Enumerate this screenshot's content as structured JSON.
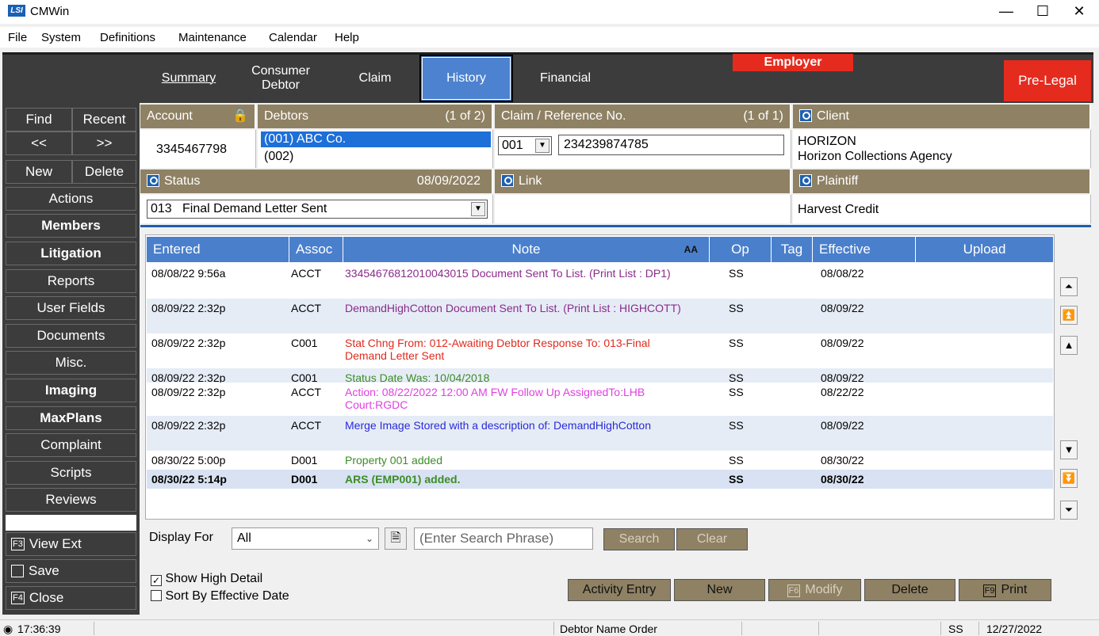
{
  "window": {
    "title": "CMWin",
    "minimize": "—",
    "maximize": "☐",
    "close": "✕"
  },
  "menu": [
    "File",
    "System",
    "Definitions",
    "Maintenance",
    "Calendar",
    "Help"
  ],
  "tabs": {
    "summary": "Summary",
    "consumer": "Consumer",
    "debtor": "Debtor",
    "claim": "Claim",
    "history": "History",
    "financial": "Financial",
    "employer": "Employer",
    "prelegal": "Pre-Legal"
  },
  "nav": {
    "find": "Find",
    "recent": "Recent",
    "prev": "<<",
    "next": ">>",
    "new": "New",
    "delete": "Delete",
    "items": [
      "Actions",
      "Members",
      "Litigation",
      "Reports",
      "User Fields",
      "Documents",
      "Misc.",
      "Imaging",
      "MaxPlans",
      "Complaint",
      "Scripts",
      "Reviews"
    ],
    "view_ext_key": "F3",
    "view_ext": "View Ext",
    "save": "Save",
    "close_key": "F4",
    "close": "Close"
  },
  "account": {
    "label": "Account",
    "value": "3345467798"
  },
  "debtors": {
    "label": "Debtors",
    "count": "(1 of 2)",
    "items": [
      "(001) ABC Co.",
      "(002)"
    ]
  },
  "claim_ref": {
    "label": "Claim / Reference No.",
    "count": "(1 of 1)",
    "select": "001",
    "value": "234239874785"
  },
  "client": {
    "label": "Client",
    "line1": "HORIZON",
    "line2": "Horizon Collections Agency"
  },
  "status": {
    "label": "Status",
    "date": "08/09/2022",
    "value": "013   Final Demand Letter Sent"
  },
  "link": {
    "label": "Link"
  },
  "plaintiff": {
    "label": "Plaintiff",
    "value": "Harvest Credit"
  },
  "grid": {
    "columns": [
      "Entered",
      "Assoc",
      "Note",
      "Op",
      "Tag",
      "Effective",
      "Upload"
    ],
    "font_icon": "AA",
    "rows": [
      {
        "entered": "08/08/22 9:56a",
        "assoc": "ACCT",
        "note": "33454676812010043015 Document Sent To List. (Print List : DP1)",
        "op": "SS",
        "effective": "08/08/22",
        "color": "#8a2b8a"
      },
      {
        "entered": "08/09/22 2:32p",
        "assoc": "ACCT",
        "note": "DemandHighCotton Document Sent To List. (Print List : HIGHCOTT)",
        "op": "SS",
        "effective": "08/09/22",
        "color": "#8a2b8a"
      },
      {
        "entered": "08/09/22 2:32p",
        "assoc": "C001",
        "note": "Stat Chng From: 012-Awaiting Debtor Response To: 013-Final Demand Letter Sent",
        "op": "SS",
        "effective": "08/09/22",
        "color": "#e02a1e"
      },
      {
        "entered": "08/09/22 2:32p",
        "assoc": "C001",
        "note": "Status Date Was: 10/04/2018",
        "op": "SS",
        "effective": "08/09/22",
        "color": "#3c8c28"
      },
      {
        "entered": "08/09/22 2:32p",
        "assoc": "ACCT",
        "note": "Action: 08/22/2022  12:00 AM  FW  Follow Up AssignedTo:LHB Court:RGDC",
        "op": "SS",
        "effective": "08/22/22",
        "color": "#e040e0"
      },
      {
        "entered": "08/09/22 2:32p",
        "assoc": "ACCT",
        "note": "Merge Image Stored with a description of: DemandHighCotton",
        "op": "SS",
        "effective": "08/09/22",
        "color": "#2a2ad8"
      },
      {
        "entered": "08/30/22 5:00p",
        "assoc": "D001",
        "note": "Property 001 added",
        "op": "SS",
        "effective": "08/30/22",
        "color": "#3c8c28"
      },
      {
        "entered": "08/30/22 5:14p",
        "assoc": "D001",
        "note": "ARS (EMP001) added.",
        "op": "SS",
        "effective": "08/30/22",
        "color": "#3c8c28"
      }
    ]
  },
  "filter": {
    "display_for_label": "Display For",
    "display_for_value": "All",
    "search_placeholder": "(Enter Search Phrase)",
    "search": "Search",
    "clear": "Clear",
    "show_high_detail": "Show High Detail",
    "sort_by_effective": "Sort By Effective Date"
  },
  "actions": {
    "activity_entry": "Activity Entry",
    "new": "New",
    "modify_key": "F6",
    "modify": "Modify",
    "delete": "Delete",
    "print_key": "F9",
    "print": "Print"
  },
  "statusbar": {
    "time": "17:36:39",
    "order": "Debtor Name Order",
    "user": "SS",
    "date": "12/27/2022"
  }
}
